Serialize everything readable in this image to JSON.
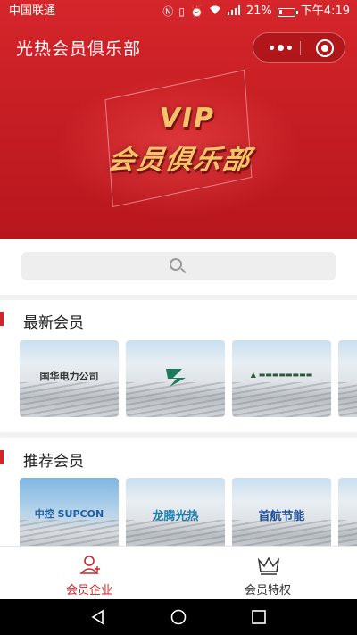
{
  "status_bar": {
    "carrier": "中国联通",
    "battery_percent": "21%",
    "battery_level": 0.21,
    "time": "下午4:19",
    "signal_label": "4G"
  },
  "app": {
    "title": "光热会员俱乐部"
  },
  "banner": {
    "headline": "VIP",
    "subheadline": "会员俱乐部"
  },
  "search": {
    "placeholder": ""
  },
  "sections": {
    "latest": {
      "title": "最新会员",
      "cards": [
        {
          "logo_text": "国华电力公司"
        },
        {
          "logo_text": ""
        },
        {
          "logo_text": ""
        }
      ]
    },
    "recommended": {
      "title": "推荐会员",
      "cards": [
        {
          "logo_text": "中控 SUPCON"
        },
        {
          "logo_text": "龙腾光热"
        },
        {
          "logo_text": "首航节能"
        }
      ]
    }
  },
  "tabbar": {
    "tabs": [
      {
        "label": "会员企业",
        "active": true
      },
      {
        "label": "会员特权",
        "active": false
      }
    ]
  },
  "colors": {
    "brand_red": "#d0232a",
    "gold": "#f5c46a"
  }
}
